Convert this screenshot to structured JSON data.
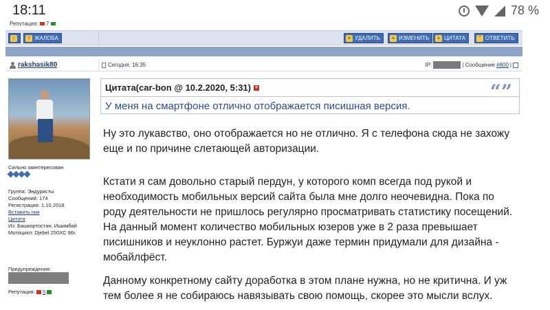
{
  "statusbar": {
    "time": "18:11",
    "battery": "78 %",
    "icons": [
      "alarm-icon",
      "wifi-icon",
      "signal-icon"
    ]
  },
  "top_reputation": {
    "label": "Репутация:",
    "value": "7"
  },
  "actions": {
    "up": "↑",
    "complaint": "ЖАЛОБА",
    "delete": "УДАЛИТЬ",
    "edit": "ИЗМЕНИТЬ",
    "quote": "ЦИТАТА",
    "reply": "ОТВЕТИТЬ"
  },
  "post": {
    "author": "rakshasik80",
    "date": "Сегодня, 16:35",
    "ip_label": "IP:",
    "message_label": "| Сообщение",
    "message_number": "#800",
    "message_sep": "|"
  },
  "profile": {
    "rank": "Сильно заинтересован",
    "stars": 4,
    "group": "Группа: Эндуристы",
    "messages": "Сообщений: 174",
    "registration": "Регистрация: 1.10.2018",
    "insert_nick": "Вставить ник",
    "quote_link": "Цитата",
    "from": "Из: Башкортостан, Ишимбай",
    "bike": "Мотоцикл: Djebel 250XC 96г.",
    "warnings_label": "Предупреждения:",
    "reputation_label": "Репутация:",
    "reputation_value": "5"
  },
  "quote": {
    "header": "Цитата(car-bon @ 10.2.2020, 5:31)",
    "text": "У меня на смартфоне отлично отображается писишная версия."
  },
  "body": {
    "p1": "Ну это лукавство, оно отображается но не отлично. Я с телефона сюда не захожу еще и по причине слетающей авторизации.",
    "p2": "Кстати я сам довольно старый пердун, у которого комп всегда под рукой и необходимость мобильных версий сайта была мне долго неочевидна. Пока по роду деятельности не пришлось регулярно просматривать статистику посещений. На данный момент количество мобильных юзеров уже в 2 раза превышает писишников и неуклонно растет. Буржуи даже термин придумали для дизайна - мобайлфёст.",
    "p3": "Данному конкретному сайту доработка в этом плане нужна, но не критична. И уж тем более я не собираюсь навязывать свою помощь, скорее это мысли вслух."
  }
}
